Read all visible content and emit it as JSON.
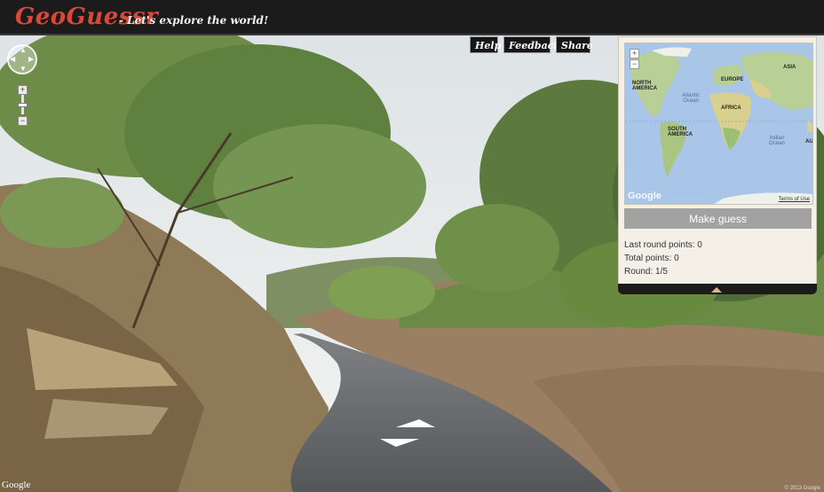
{
  "header": {
    "logo": "GeoGuessr",
    "tagline": "- Let's explore the world!"
  },
  "toolbar": {
    "help_label": "Help",
    "feedback_label": "Feedback",
    "share_label": "Share"
  },
  "minimap": {
    "labels": {
      "north_america": "NORTH AMERICA",
      "south_america": "SOUTH AMERICA",
      "europe": "EUROPE",
      "africa": "AFRICA",
      "asia": "ASIA",
      "au": "AU",
      "atlantic": "Atlantic Ocean",
      "indian": "Indian Ocean"
    },
    "google_mark": "Google",
    "terms_label": "Terms of Use",
    "zoom_in": "+",
    "zoom_out": "−"
  },
  "guess": {
    "button_label": "Make guess",
    "last_round_points": "Last round points: 0",
    "total_points": "Total points: 0",
    "round": "Round: 1/5"
  },
  "streetview": {
    "google_mark": "Google",
    "copyright": "© 2013 Google"
  },
  "colors": {
    "brand": "#d8493a",
    "header_bg": "#1b1b1b",
    "panel_bg": "#f4f0e7",
    "guess_button": "#a2a2a2"
  }
}
